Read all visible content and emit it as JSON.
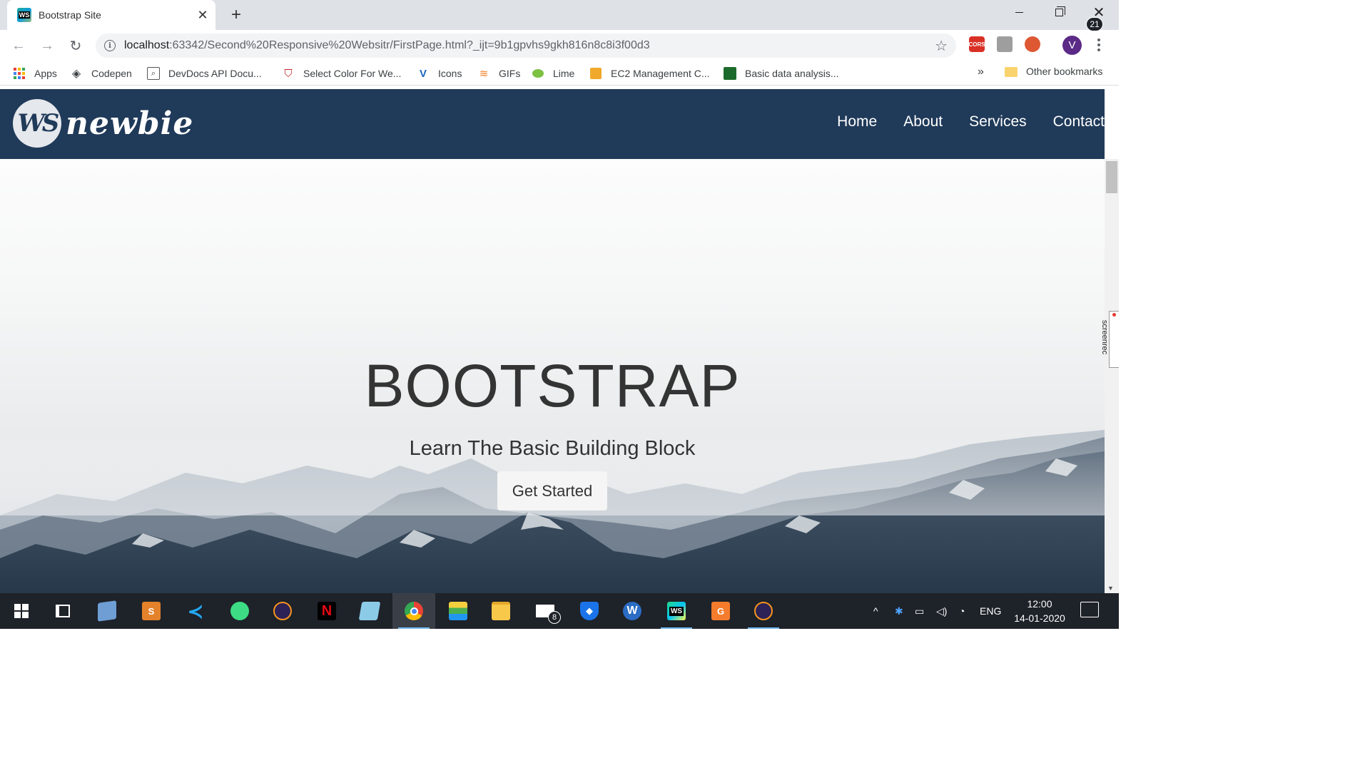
{
  "browser": {
    "tab_title": "Bootstrap Site",
    "tab_favicon_text": "WS",
    "url_host": "localhost",
    "url_path": ":63342/Second%20Responsive%20Websitr/FirstPage.html?_ijt=9b1gpvhs9gkh816n8c8i3f00d3",
    "extensions": [
      "CORS",
      "cube",
      "duckduckgo"
    ],
    "cors_label": "CORS",
    "avatar_letter": "V"
  },
  "bookmarks": {
    "items": [
      {
        "label": "Apps",
        "icon": "apps-grid-icon"
      },
      {
        "label": "Codepen",
        "icon": "codepen-icon"
      },
      {
        "label": "DevDocs API Docu...",
        "icon": "devdocs-icon"
      },
      {
        "label": "Select Color For We...",
        "icon": "color-icon"
      },
      {
        "label": "Icons",
        "icon": "vuetify-icon"
      },
      {
        "label": "GIFs",
        "icon": "gifs-icon"
      },
      {
        "label": "Lime",
        "icon": "lime-icon"
      },
      {
        "label": "EC2 Management C...",
        "icon": "aws-icon"
      },
      {
        "label": "Basic data analysis...",
        "icon": "analysis-icon"
      }
    ],
    "more": "»",
    "other": "Other bookmarks"
  },
  "site": {
    "logo_mark": "WS",
    "logo_text": "newbie",
    "nav": [
      "Home",
      "About",
      "Services",
      "Contact"
    ],
    "hero_title": "BOOTSTRAP",
    "hero_subtitle": "Learn The Basic Building Block",
    "hero_button": "Get Started"
  },
  "overlay": {
    "screenrec_label": "screenrec"
  },
  "taskbar": {
    "apps": [
      "start",
      "task-view",
      "virtualbox",
      "sublime-text",
      "vscode",
      "android-studio",
      "eclipse",
      "netflix",
      "notepad",
      "chrome",
      "bluestacks",
      "file-explorer",
      "mail",
      "brave",
      "wps",
      "webstorm",
      "pdf-reader",
      "eclipse-2"
    ],
    "mail_badge": "8",
    "language": "ENG",
    "time": "12:00",
    "date": "14-01-2020",
    "notifications": "21"
  }
}
